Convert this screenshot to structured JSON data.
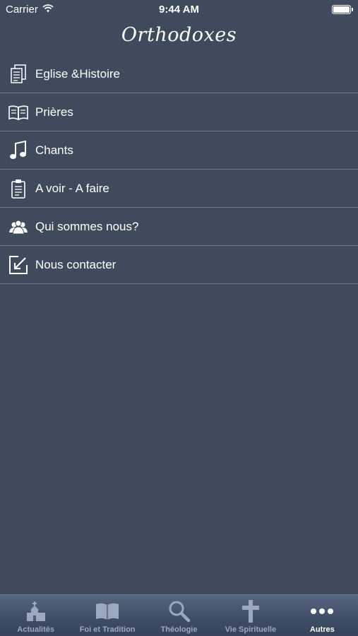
{
  "status_bar": {
    "carrier": "Carrier",
    "time": "9:44 AM"
  },
  "nav": {
    "title": "Orthodoxes"
  },
  "menu": {
    "items": [
      {
        "label": "Eglise &Histoire",
        "icon": "documents-icon"
      },
      {
        "label": "Prières",
        "icon": "open-book-icon"
      },
      {
        "label": "Chants",
        "icon": "music-note-icon"
      },
      {
        "label": "A voir - A faire",
        "icon": "clipboard-icon"
      },
      {
        "label": "Qui sommes nous?",
        "icon": "people-icon"
      },
      {
        "label": "Nous contacter",
        "icon": "compose-icon"
      }
    ]
  },
  "tab_bar": {
    "tabs": [
      {
        "label": "Actualités",
        "icon": "church-icon"
      },
      {
        "label": "Foi et Tradition",
        "icon": "book-icon"
      },
      {
        "label": "Théologie",
        "icon": "magnifier-icon"
      },
      {
        "label": "Vie Spirituelle",
        "icon": "cross-icon"
      },
      {
        "label": "Autres",
        "icon": "more-dots-icon"
      }
    ],
    "active": "Autres"
  },
  "colors": {
    "background": "#3f4b5c",
    "separator": "#6d7888",
    "tab_inactive": "#9aa9bc"
  }
}
